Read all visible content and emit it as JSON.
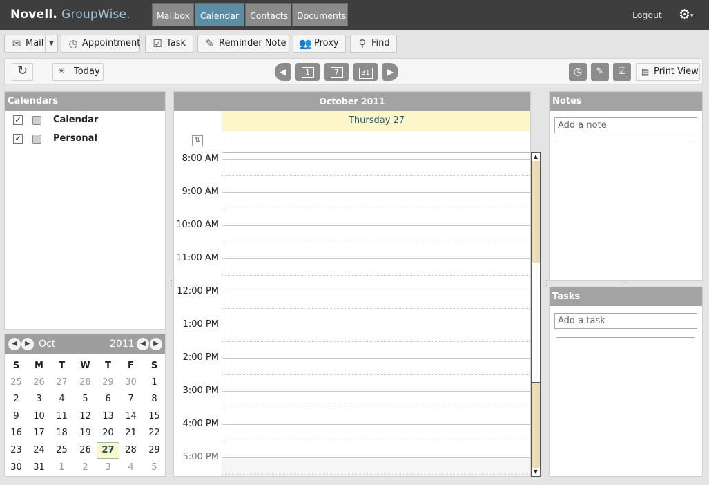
{
  "brand": {
    "novell": "Novell",
    "dot": ".",
    "groupwise": "GroupWise",
    "dot2": "."
  },
  "nav": {
    "tabs": [
      "Mailbox",
      "Calendar",
      "Contacts",
      "Documents"
    ],
    "active": "Calendar",
    "logout": "Logout"
  },
  "toolbar": {
    "mail": "Mail",
    "appointment": "Appointment",
    "task": "Task",
    "reminder_note": "Reminder Note",
    "proxy": "Proxy",
    "find": "Find"
  },
  "subbar": {
    "today": "Today",
    "print_view": "Print View",
    "view_day_icon": "1",
    "view_week_icon": "7",
    "view_month_icon": "31"
  },
  "calendars": {
    "title": "Calendars",
    "items": [
      {
        "label": "Calendar",
        "checked": true
      },
      {
        "label": "Personal",
        "checked": true
      }
    ]
  },
  "minical": {
    "month": "Oct",
    "year": "2011",
    "weekdays": [
      "S",
      "M",
      "T",
      "W",
      "T",
      "F",
      "S"
    ],
    "weeks": [
      [
        "25",
        "26",
        "27",
        "28",
        "29",
        "30",
        "1"
      ],
      [
        "2",
        "3",
        "4",
        "5",
        "6",
        "7",
        "8"
      ],
      [
        "9",
        "10",
        "11",
        "12",
        "13",
        "14",
        "15"
      ],
      [
        "16",
        "17",
        "18",
        "19",
        "20",
        "21",
        "22"
      ],
      [
        "23",
        "24",
        "25",
        "26",
        "27",
        "28",
        "29"
      ],
      [
        "30",
        "31",
        "1",
        "2",
        "3",
        "4",
        "5"
      ]
    ],
    "today": "27"
  },
  "dayview": {
    "title": "October 2011",
    "date_label": "Thursday 27",
    "times": [
      "8:00 AM",
      "9:00 AM",
      "10:00 AM",
      "11:00 AM",
      "12:00 PM",
      "1:00 PM",
      "2:00 PM",
      "3:00 PM",
      "4:00 PM",
      "5:00 PM"
    ]
  },
  "notes": {
    "title": "Notes",
    "placeholder": "Add a note"
  },
  "tasks": {
    "title": "Tasks",
    "placeholder": "Add a task"
  },
  "colors": {
    "topbar": "#3e3e3e",
    "active_tab": "#5b8ea6",
    "panel_header": "#a3a3a3",
    "today_highlight": "#fdf6c8",
    "scroll_track": "#eadcb6"
  }
}
